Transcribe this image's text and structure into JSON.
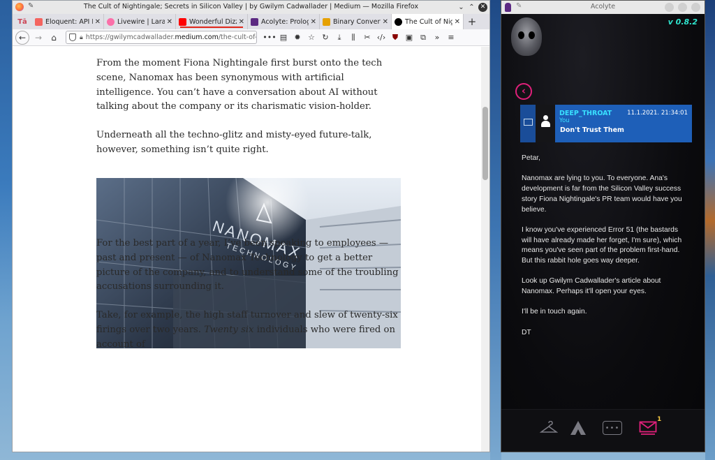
{
  "firefox": {
    "window_title": "The Cult of Nightingale; Secrets in Silicon Valley | by Gwilym Cadwallader | Medium — Mozilla Firefox",
    "tabs": [
      {
        "label": "Eloquent: API Re",
        "favicon_color": "#f4645f"
      },
      {
        "label": "Livewire | Larave",
        "favicon_color": "#fb70a9"
      },
      {
        "label": "Wonderful Dizzy",
        "favicon_color": "#ff0000"
      },
      {
        "label": "Acolyte: Prologu",
        "favicon_color": "#5c2a82"
      },
      {
        "label": "Binary Converter",
        "favicon_color": "#e6a100"
      },
      {
        "label": "The Cult of Nigh",
        "favicon_color": "#000000"
      }
    ],
    "url": {
      "prefix": "https://gwilymcadwallader.",
      "domain": "medium.com",
      "path": "/the-cult-of-night"
    }
  },
  "article": {
    "paragraphs": [
      "From the moment Fiona Nightingale first burst onto the tech scene, Nanomax has been synonymous with artificial intelligence. You can’t have a conversation about AI without talking about the company or its charismatic vision-holder.",
      "Underneath all the techno-glitz and misty-eyed future-talk, however, something isn’t quite right.",
      "For the best part of a year, I’ve been speaking to employees — past and present — of Nanomax Technology to get a better picture of the company, and to understand some of the troubling accusations surrounding it.",
      "Take, for example, the high staff turnover and slew of twenty-six firings over two years."
    ],
    "p4_italic": "Twenty six",
    "p4_tail": " individuals who were fired on account of",
    "image": {
      "sign_line1": "NANOMAX",
      "sign_line2": "TECHNOLOGY"
    }
  },
  "acolyte": {
    "window_title": "Acolyte",
    "version": "v 0.8.2",
    "message": {
      "from": "DEEP_THROAT",
      "to": "You",
      "datetime": "11.1.2021. 21:34:01",
      "subject": "Don't Trust Them",
      "body": [
        "Petar,",
        "Nanomax are lying to you. To everyone. Ana's development is far from the Silicon Valley success story Fiona Nightingale's PR team would have you believe.",
        "I know you've experienced Error 51 (the bastards will have already made her forget, I'm sure), which means you've seen part of the problem first-hand. But this rabbit hole goes way deeper.",
        "Look up Gwilym Cadwallader's article about Nanomax. Perhaps it'll open your eyes.",
        "I'll be in touch again.",
        "DT"
      ]
    },
    "nav": {
      "mail_badge": "1"
    },
    "colors": {
      "accent": "#e0207a",
      "version": "#2fe6cf",
      "header_bg": "#1e5fb8",
      "from": "#39e0ff"
    }
  }
}
